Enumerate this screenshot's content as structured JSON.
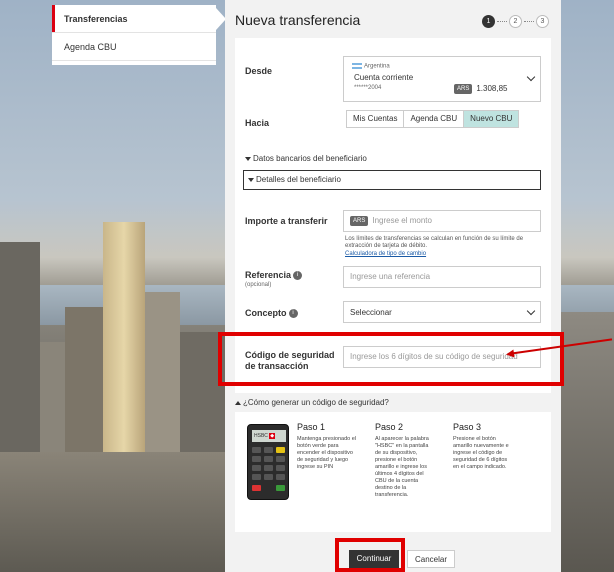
{
  "nav": {
    "items": [
      {
        "label": "Transferencias",
        "active": true
      },
      {
        "label": "Agenda CBU",
        "active": false
      }
    ]
  },
  "page": {
    "title": "Nueva transferencia",
    "steps": [
      "1",
      "2",
      "3"
    ],
    "current_step": 1
  },
  "form": {
    "desde": {
      "label": "Desde",
      "country": "Argentina",
      "account_type": "Cuenta corriente",
      "account_number": "******2004",
      "currency": "ARS",
      "balance": "1.308,85"
    },
    "hacia": {
      "label": "Hacia",
      "options": [
        {
          "label": "Mis Cuentas",
          "active": false
        },
        {
          "label": "Agenda CBU",
          "active": false
        },
        {
          "label": "Nuevo CBU",
          "active": true
        }
      ]
    },
    "datos_bancarios": "Datos bancarios del beneficiario",
    "detalles": "Detalles del beneficiario",
    "importe": {
      "label": "Importe a transferir",
      "currency": "ARS",
      "placeholder": "Ingrese el monto",
      "note": "Los límites de transferencias se calculan en función de su límite de extracción de tarjeta de débito.",
      "link": "Calculadora de tipo de cambio"
    },
    "referencia": {
      "label": "Referencia",
      "sublabel": "(opcional)",
      "placeholder": "Ingrese una referencia"
    },
    "concepto": {
      "label": "Concepto",
      "value": "Seleccionar"
    },
    "codigo": {
      "label_line1": "Código de seguridad",
      "label_line2": "de transacción",
      "placeholder": "Ingrese los 6 dígitos de su código de seguridad"
    }
  },
  "help": {
    "toggle": "¿Cómo generar un código de seguridad?",
    "device_brand": "HSBC",
    "steps": [
      {
        "title": "Paso 1",
        "text": "Mantenga presionado el botón verde para encender el dispositivo de seguridad y luego ingrese su PIN"
      },
      {
        "title": "Paso 2",
        "text": "Al aparecer la palabra \"HSBC\" en la pantalla de su dispositivo, presione el botón amarillo e ingrese los últimos 4 dígitos del CBU de la cuenta destino de la transferencia."
      },
      {
        "title": "Paso 3",
        "text": "Presione el botón amarillo nuevamente e ingrese el código de seguridad de 6 dígitos en el campo indicado."
      }
    ]
  },
  "actions": {
    "continue": "Continuar",
    "cancel": "Cancelar"
  },
  "colors": {
    "accent": "#db0011",
    "highlight": "#e00000",
    "segment_active": "#bfe3e0"
  }
}
